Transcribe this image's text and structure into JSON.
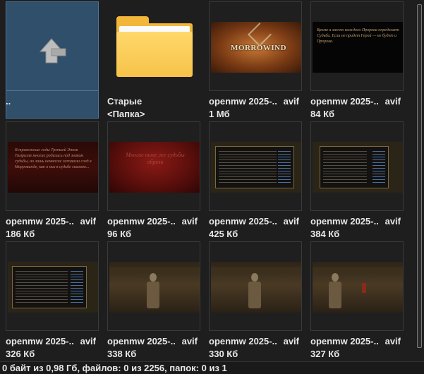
{
  "items": [
    {
      "name": "..",
      "ext": "",
      "size": "",
      "kind": "parent"
    },
    {
      "name": "Старые",
      "ext": "",
      "size": "<Папка>",
      "kind": "folder"
    },
    {
      "name": "openmw 2025-..",
      "ext": "avif",
      "size": "1 Мб",
      "kind": "morrowind"
    },
    {
      "name": "openmw 2025-..",
      "ext": "avif",
      "size": "84 Кб",
      "kind": "blacktext"
    },
    {
      "name": "openmw 2025-..",
      "ext": "avif",
      "size": "186 Кб",
      "kind": "redtext"
    },
    {
      "name": "openmw 2025-..",
      "ext": "avif",
      "size": "96 Кб",
      "kind": "blood"
    },
    {
      "name": "openmw 2025-..",
      "ext": "avif",
      "size": "425 Кб",
      "kind": "ui"
    },
    {
      "name": "openmw 2025-..",
      "ext": "avif",
      "size": "384 Кб",
      "kind": "ui"
    },
    {
      "name": "openmw 2025-..",
      "ext": "avif",
      "size": "326 Кб",
      "kind": "ui"
    },
    {
      "name": "openmw 2025-..",
      "ext": "avif",
      "size": "338 Кб",
      "kind": "scene"
    },
    {
      "name": "openmw 2025-..",
      "ext": "avif",
      "size": "330 Кб",
      "kind": "scene"
    },
    {
      "name": "openmw 2025-..",
      "ext": "avif",
      "size": "327 Кб",
      "kind": "scene"
    }
  ],
  "thumb_text": {
    "morrowind_logo": "MORROWIND",
    "blacktext": "Время и место каждого Пророка определяет Судьба. Если не придет Герой — не будет и Пророка.",
    "redtext": "В тревожные годы Третьей Эпохи Тамриэля многие родились под знаком судьбы, но лишь немногие оставили след в Морровинде, как о них в судьбе сказано...",
    "blood": "Многие ныне же судьбы обрели"
  },
  "status": "0 байт из 0,98 Гб, файлов: 0 из 2256, папок: 0 из 1",
  "colors": {
    "background": "#1e1e1e",
    "selection": "#2f4f6b",
    "folder": "#f2b63a",
    "text": "#e8e8e8"
  }
}
